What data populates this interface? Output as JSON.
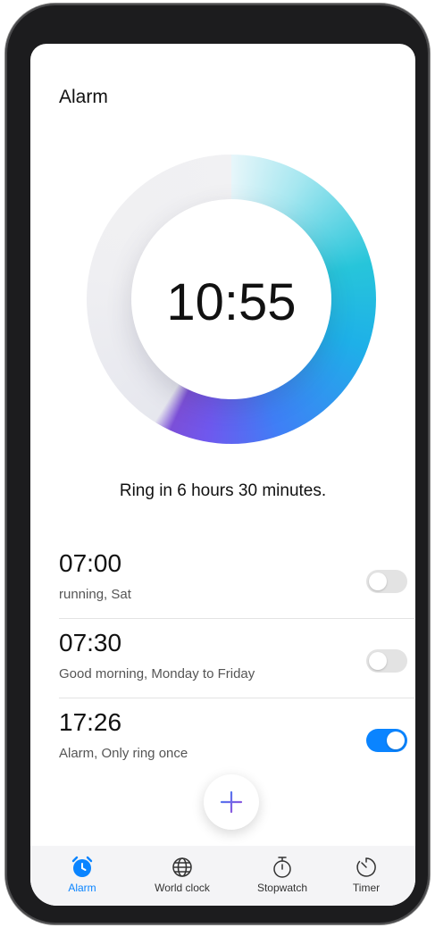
{
  "header": {
    "title": "Alarm"
  },
  "dial": {
    "time": "10:55"
  },
  "ring_message": "Ring in 6 hours 30 minutes.",
  "alarms": [
    {
      "time": "07:00",
      "label": "running, Sat",
      "enabled": false
    },
    {
      "time": "07:30",
      "label": "Good morning, Monday to Friday",
      "enabled": false
    },
    {
      "time": "17:26",
      "label": "Alarm, Only ring once",
      "enabled": true
    }
  ],
  "fab": {
    "icon": "plus-icon"
  },
  "tabs": [
    {
      "label": "Alarm",
      "icon": "alarm-clock-icon",
      "active": true
    },
    {
      "label": "World clock",
      "icon": "globe-icon",
      "active": false
    },
    {
      "label": "Stopwatch",
      "icon": "stopwatch-icon",
      "active": false
    },
    {
      "label": "Timer",
      "icon": "timer-icon",
      "active": false
    }
  ],
  "colors": {
    "accent": "#0a84ff",
    "toggle_off": "#e3e3e3",
    "ring_start": "#27c5da",
    "ring_end": "#7b4fd8"
  }
}
